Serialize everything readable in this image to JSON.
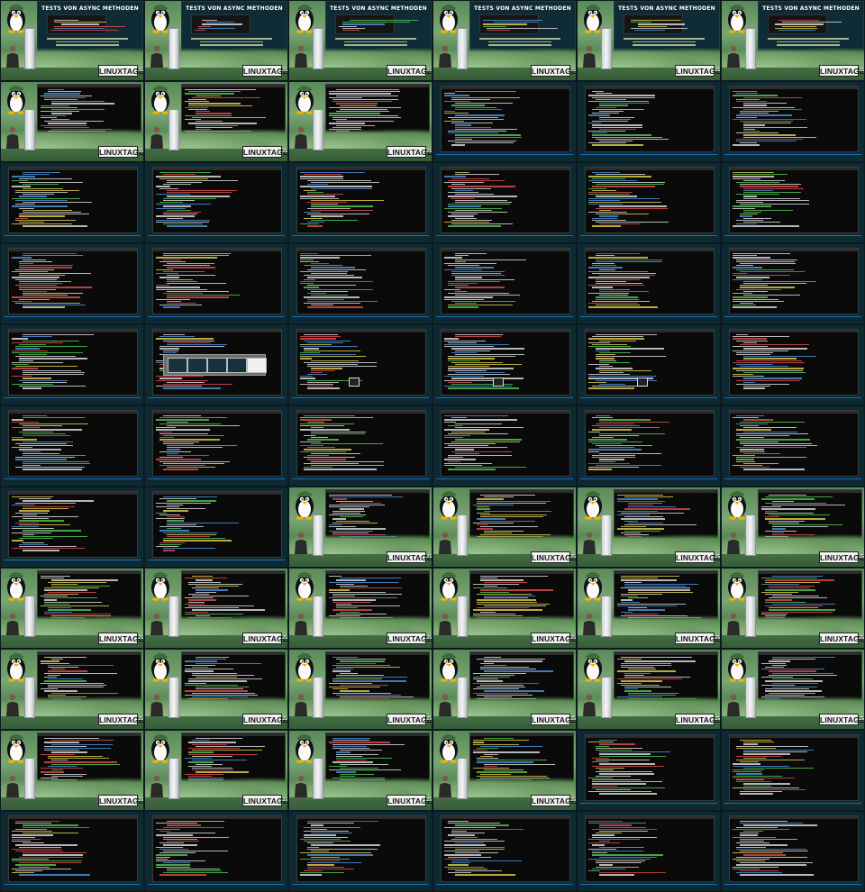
{
  "contact_sheet": {
    "rows": 11,
    "cols": 6,
    "colors": {
      "background": "#0b1a20",
      "screen_bg": "#0d2a33",
      "terminal_bg": "#0a0a0a",
      "stage_green": "#6b9a62",
      "code_green": "#4fc24f",
      "code_yellow": "#d8c84a",
      "code_white": "#d6d6d6",
      "code_blue": "#4a8fd8",
      "code_red": "#d84a4a"
    },
    "slide": {
      "title": "TESTS VON ASYNC METHODEN"
    },
    "brand": {
      "logo_text": "LINUXTAGE",
      "year_mark": "25"
    },
    "tiles": [
      {
        "kind": "stage-slide"
      },
      {
        "kind": "stage-slide"
      },
      {
        "kind": "stage-slide"
      },
      {
        "kind": "stage-slide"
      },
      {
        "kind": "stage-slide"
      },
      {
        "kind": "stage-slide"
      },
      {
        "kind": "stage-code"
      },
      {
        "kind": "stage-code"
      },
      {
        "kind": "stage-code"
      },
      {
        "kind": "screen-code"
      },
      {
        "kind": "screen-code"
      },
      {
        "kind": "screen-code"
      },
      {
        "kind": "screen-code"
      },
      {
        "kind": "screen-code"
      },
      {
        "kind": "screen-code"
      },
      {
        "kind": "screen-code"
      },
      {
        "kind": "screen-code"
      },
      {
        "kind": "screen-code"
      },
      {
        "kind": "screen-code"
      },
      {
        "kind": "screen-code"
      },
      {
        "kind": "screen-code"
      },
      {
        "kind": "screen-code"
      },
      {
        "kind": "screen-code"
      },
      {
        "kind": "screen-code"
      },
      {
        "kind": "screen-code"
      },
      {
        "kind": "screen-taskbar"
      },
      {
        "kind": "screen-tooltip"
      },
      {
        "kind": "screen-tooltip"
      },
      {
        "kind": "screen-tooltip"
      },
      {
        "kind": "screen-code"
      },
      {
        "kind": "screen-code"
      },
      {
        "kind": "screen-code"
      },
      {
        "kind": "screen-code"
      },
      {
        "kind": "screen-code"
      },
      {
        "kind": "screen-code"
      },
      {
        "kind": "screen-code"
      },
      {
        "kind": "screen-code"
      },
      {
        "kind": "screen-code"
      },
      {
        "kind": "stage-code"
      },
      {
        "kind": "stage-code"
      },
      {
        "kind": "stage-code"
      },
      {
        "kind": "stage-code"
      },
      {
        "kind": "stage-code"
      },
      {
        "kind": "stage-code"
      },
      {
        "kind": "stage-code"
      },
      {
        "kind": "stage-code"
      },
      {
        "kind": "stage-code"
      },
      {
        "kind": "stage-code"
      },
      {
        "kind": "stage-code"
      },
      {
        "kind": "stage-code"
      },
      {
        "kind": "stage-code"
      },
      {
        "kind": "stage-code"
      },
      {
        "kind": "stage-code"
      },
      {
        "kind": "stage-code"
      },
      {
        "kind": "stage-code"
      },
      {
        "kind": "stage-code"
      },
      {
        "kind": "stage-code"
      },
      {
        "kind": "stage-code"
      },
      {
        "kind": "screen-code"
      },
      {
        "kind": "screen-code"
      },
      {
        "kind": "screen-code"
      },
      {
        "kind": "screen-code"
      },
      {
        "kind": "screen-code"
      },
      {
        "kind": "screen-code"
      },
      {
        "kind": "screen-code"
      },
      {
        "kind": "screen-code"
      }
    ]
  }
}
